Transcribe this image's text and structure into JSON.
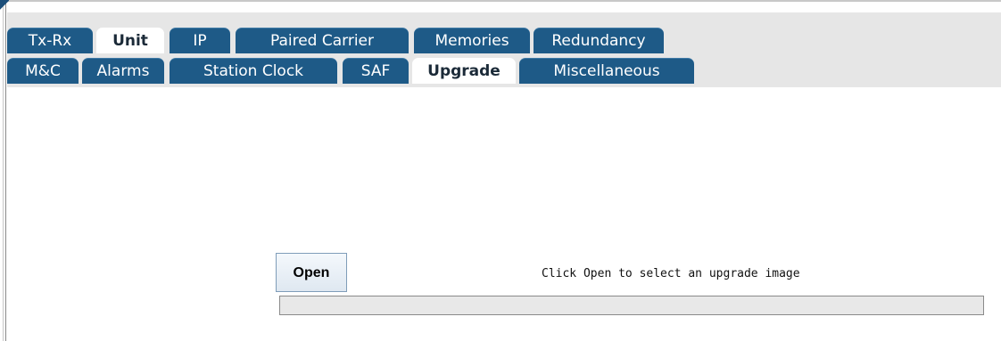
{
  "tabs": {
    "row1": [
      {
        "label": "Tx-Rx",
        "selected": false
      },
      {
        "label": "Unit",
        "selected": true
      },
      {
        "label": "IP",
        "selected": false
      },
      {
        "label": "Paired Carrier",
        "selected": false
      },
      {
        "label": "Memories",
        "selected": false
      },
      {
        "label": "Redundancy",
        "selected": false
      }
    ],
    "row2": [
      {
        "label": "M&C",
        "selected": false
      },
      {
        "label": "Alarms",
        "selected": false
      },
      {
        "label": "Station Clock",
        "selected": false
      },
      {
        "label": "SAF",
        "selected": false
      },
      {
        "label": "Upgrade",
        "selected": true
      },
      {
        "label": "Miscellaneous",
        "selected": false
      }
    ]
  },
  "upgrade": {
    "open_label": "Open",
    "hint": "Click Open to select an upgrade image",
    "progress_fraction": 0
  },
  "colors": {
    "tab_background": "#1e5a87",
    "tab_text": "#ffffff",
    "selected_tab_background": "#ffffff",
    "tabbar_background": "#e6e6e6"
  }
}
